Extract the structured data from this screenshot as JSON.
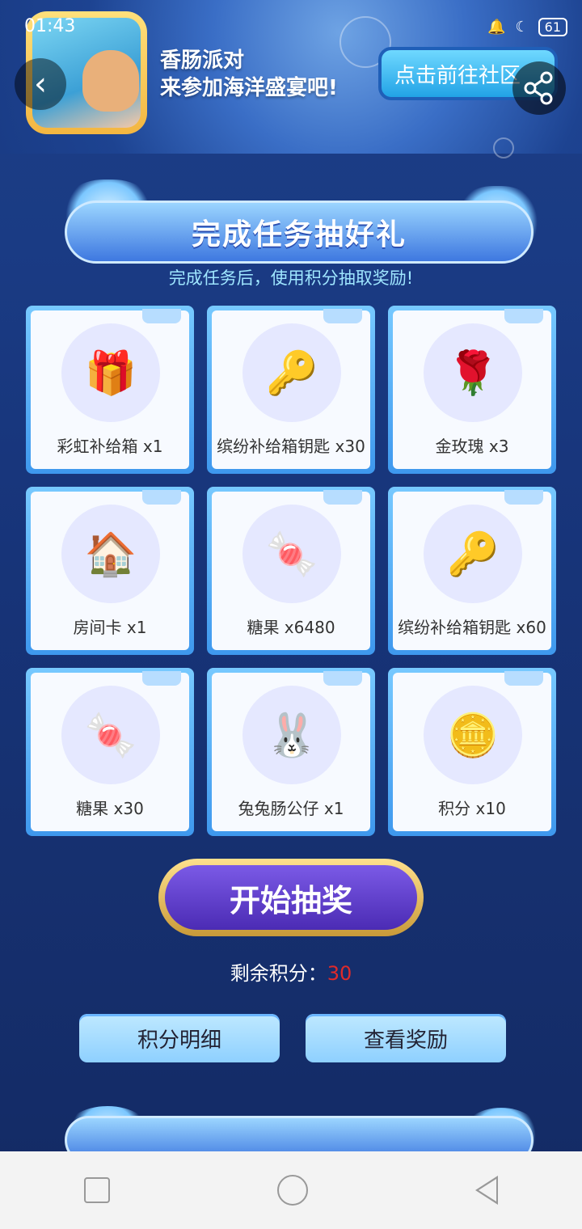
{
  "status": {
    "time": "01:43",
    "battery": "61"
  },
  "header": {
    "title_line1": "香肠派对",
    "title_line2": "来参加海洋盛宴吧!",
    "community_button": "点击前往社区"
  },
  "section": {
    "title": "完成任务抽好礼",
    "subtitle": "完成任务后，使用积分抽取奖励!"
  },
  "rewards": [
    {
      "label": "彩虹补给箱 x1",
      "icon": "crate-icon"
    },
    {
      "label": "缤纷补给箱钥匙 x30",
      "icon": "keys-icon"
    },
    {
      "label": "金玫瑰 x3",
      "icon": "gold-rose-icon"
    },
    {
      "label": "房间卡 x1",
      "icon": "room-card-icon"
    },
    {
      "label": "糖果 x6480",
      "icon": "candy-pile-icon"
    },
    {
      "label": "缤纷补给箱钥匙 x60",
      "icon": "keys-icon"
    },
    {
      "label": "糖果 x30",
      "icon": "candy-icon"
    },
    {
      "label": "兔兔肠公仔 x1",
      "icon": "bunny-plush-icon"
    },
    {
      "label": "积分 x10",
      "icon": "points-coin-icon"
    }
  ],
  "draw": {
    "start_button": "开始抽奖",
    "remaining_label": "剩余积分：",
    "remaining_value": "30"
  },
  "buttons": {
    "points_detail": "积分明细",
    "view_rewards": "查看奖励"
  },
  "colors": {
    "accent": "#22a3e6",
    "points_red": "#e02a2a"
  }
}
